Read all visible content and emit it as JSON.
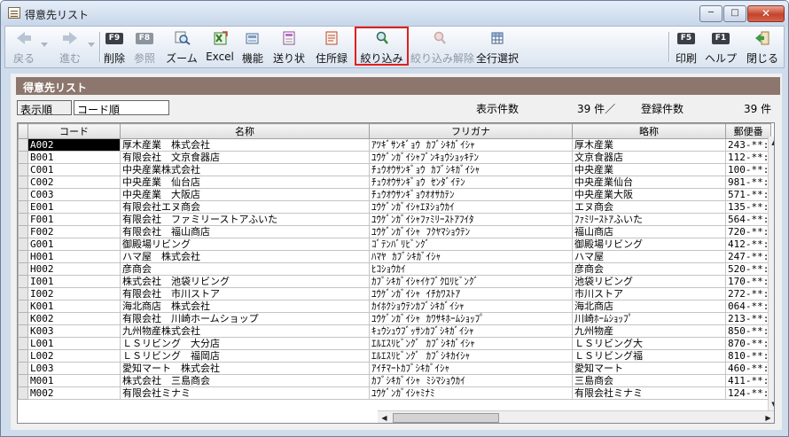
{
  "window": {
    "title": "得意先リスト"
  },
  "toolbar": {
    "back": "戻る",
    "forward": "進む",
    "delete_key": "F9",
    "delete": "削除",
    "ref_key": "F8",
    "reference": "参照",
    "zoom": "ズーム",
    "excel": "Excel",
    "function": "機能",
    "invoice": "送り状",
    "address_book": "住所録",
    "filter": "絞り込み",
    "filter_clear": "絞り込み解除",
    "select_all": "全行選択",
    "print_key": "F5",
    "print": "印刷",
    "help_key": "F1",
    "help": "ヘルプ",
    "close": "閉じる"
  },
  "section": {
    "title": "得意先リスト"
  },
  "info": {
    "sort_label": "表示順",
    "sort_value": "コード順",
    "display_label": "表示件数",
    "display_count": "39 件／",
    "total_label": "登録件数",
    "total_count": "39 件"
  },
  "table": {
    "headers": {
      "code": "コード",
      "name": "名称",
      "kana": "フリガナ",
      "short": "略称",
      "zip": "郵便番"
    },
    "rows": [
      {
        "code": "A002",
        "name": "厚木産業　株式会社",
        "kana": "ｱﾂｷﾞｻﾝｷﾞｮｳ ｶﾌﾞｼｷｶﾞｲｼｬ",
        "short": "厚木産業",
        "zip": "243-**:"
      },
      {
        "code": "B001",
        "name": "有限会社　文京食器店",
        "kana": "ﾕｳｹﾞﾝｶﾞｲｼｬﾌﾞﾝｷｮｳｼｮｯｷﾃﾝ",
        "short": "文京食器店",
        "zip": "112-**:"
      },
      {
        "code": "C001",
        "name": "中央産業株式会社",
        "kana": "ﾁｭｳｵｳｻﾝｷﾞｮｳ ｶﾌﾞｼｷｶﾞｲｼｬ",
        "short": "中央産業",
        "zip": "100-**:"
      },
      {
        "code": "C002",
        "name": "中央産業　仙台店",
        "kana": "ﾁｭｳｵｳｻﾝｷﾞｮｳ ｾﾝﾀﾞｲﾃﾝ",
        "short": "中央産業仙台",
        "zip": "981-**:"
      },
      {
        "code": "C003",
        "name": "中央産業　大阪店",
        "kana": "ﾁｭｳｵｳｻﾝｷﾞｮｳｵｵｻｶﾃﾝ",
        "short": "中央産業大阪",
        "zip": "571-**:"
      },
      {
        "code": "E001",
        "name": "有限会社エヌ商会",
        "kana": "ﾕｳｹﾞﾝｶﾞｲｼｬｴﾇｼｮｳｶｲ",
        "short": "エヌ商会",
        "zip": "135-**:"
      },
      {
        "code": "F001",
        "name": "有限会社　ファミリーストアふいた",
        "kana": "ﾕｳｹﾞﾝｶﾞｲｼｬﾌｧﾐﾘｰｽﾄｱﾌｲﾀ",
        "short": "ﾌｧﾐﾘｰｽﾄｱふいた",
        "zip": "564-**:"
      },
      {
        "code": "F002",
        "name": "有限会社　福山商店",
        "kana": "ﾕｳｹﾞﾝｶﾞｲｼｬ ﾌｸﾔﾏｼｮｳﾃﾝ",
        "short": "福山商店",
        "zip": "720-**:"
      },
      {
        "code": "G001",
        "name": "御殿場リビング",
        "kana": "ｺﾞﾃﾝﾊﾞﾘﾋﾞﾝｸﾞ",
        "short": "御殿場リビング",
        "zip": "412-**:"
      },
      {
        "code": "H001",
        "name": "ハマ屋　株式会社",
        "kana": "ﾊﾏﾔ ｶﾌﾞｼｷｶﾞｲｼｬ",
        "short": "ハマ屋",
        "zip": "247-**:"
      },
      {
        "code": "H002",
        "name": "彦商会",
        "kana": "ﾋｺｼｮｳｶｲ",
        "short": "彦商会",
        "zip": "520-**:"
      },
      {
        "code": "I001",
        "name": "株式会社　池袋リビング",
        "kana": "ｶﾌﾞｼｷｶﾞｲｼｬｲｹﾌﾞｸﾛﾘﾋﾞﾝｸﾞ",
        "short": "池袋リビング",
        "zip": "170-**:"
      },
      {
        "code": "I002",
        "name": "有限会社　市川ストア",
        "kana": "ﾕｳｹﾞﾝｶﾞｲｼｬ ｲﾁｶﾜｽﾄｱ",
        "short": "市川ストア",
        "zip": "272-**:"
      },
      {
        "code": "K001",
        "name": "海北商店　株式会社",
        "kana": "ｶｲﾎｸｼｮｳﾃﾝｶﾌﾞｼｷｶﾞｲｼｬ",
        "short": "海北商店",
        "zip": "064-**:"
      },
      {
        "code": "K002",
        "name": "有限会社　川崎ホームショップ",
        "kana": "ﾕｳｹﾞﾝｶﾞｲｼｬ ｶﾜｻｷﾎｰﾑｼｮｯﾌﾟ",
        "short": "川崎ﾎｰﾑｼｮｯﾌﾟ",
        "zip": "213-**:"
      },
      {
        "code": "K003",
        "name": "九州物産株式会社",
        "kana": "ｷｭｳｼｭｳﾌﾞｯｻﾝｶﾌﾞｼｷｶﾞｲｼｬ",
        "short": "九州物産",
        "zip": "850-**:"
      },
      {
        "code": "L001",
        "name": "ＬＳリビング　大分店",
        "kana": "ｴﾙｴｽﾘﾋﾞﾝｸﾞ ｶﾌﾞｼｷｶﾞｲｼｬ",
        "short": "ＬＳリビング大",
        "zip": "870-**:"
      },
      {
        "code": "L002",
        "name": "ＬＳリビング　福岡店",
        "kana": "ｴﾙｴｽﾘﾋﾞﾝｸﾞ ｶﾌﾞｼｷｶｲｼｬ",
        "short": "ＬＳリビング福",
        "zip": "810-**:"
      },
      {
        "code": "L003",
        "name": "愛知マート　株式会社",
        "kana": "ｱｲﾁﾏｰﾄｶﾌﾞｼｷｶﾞｲｼｬ",
        "short": "愛知マート",
        "zip": "460-**:"
      },
      {
        "code": "M001",
        "name": "株式会社　三島商会",
        "kana": "ｶﾌﾞｼｷｶﾞｲｼｬ ﾐｼﾏｼｮｳｶｲ",
        "short": "三島商会",
        "zip": "411-**:"
      },
      {
        "code": "M002",
        "name": "有限会社ミナミ",
        "kana": "ﾕｳｹﾞﾝｶﾞｲｼｬﾐﾅﾐ",
        "short": "有限会社ミナミ",
        "zip": "124-**:"
      }
    ]
  },
  "colors": {
    "section_bar": "#8c766d",
    "highlight": "#e0201b",
    "selected_cell": "#000000"
  }
}
